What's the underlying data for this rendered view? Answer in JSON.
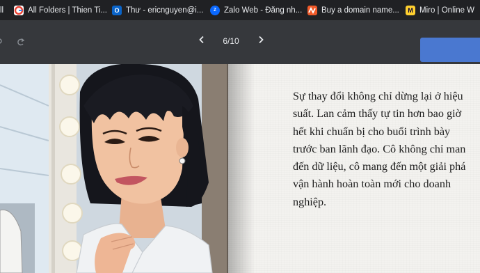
{
  "bookmarks": [
    {
      "label": "ll",
      "icon": "none"
    },
    {
      "label": "All Folders | Thien Ti...",
      "icon": "google-icon"
    },
    {
      "label": "Thư - ericnguyen@i...",
      "icon": "outlook-icon"
    },
    {
      "label": "Zalo Web - Đăng nh...",
      "icon": "zalo-icon"
    },
    {
      "label": "Buy a domain name...",
      "icon": "namecheap-icon"
    },
    {
      "label": "Miro | Online W",
      "icon": "miro-icon"
    }
  ],
  "viewer": {
    "page_indicator": "6/10",
    "prev_icon": "chevron-left-icon",
    "next_icon": "chevron-right-icon"
  },
  "colors": {
    "toolbar": "#36383c",
    "bookmarks_bar": "#202124",
    "accent_button": "#4a78d0",
    "paper": "#f3f2ef"
  },
  "story": {
    "lines": [
      "Sự thay đổi không chỉ dừng lại ở hiệu",
      "suất. Lan cảm thấy tự tin hơn bao giờ",
      "hết khi chuẩn bị cho buổi trình bày",
      "trước ban lãnh đạo. Cô không chỉ man",
      "đến dữ liệu, cô mang đến một giải phá",
      "vận hành hoàn toàn mới cho doanh",
      "nghiệp."
    ]
  }
}
